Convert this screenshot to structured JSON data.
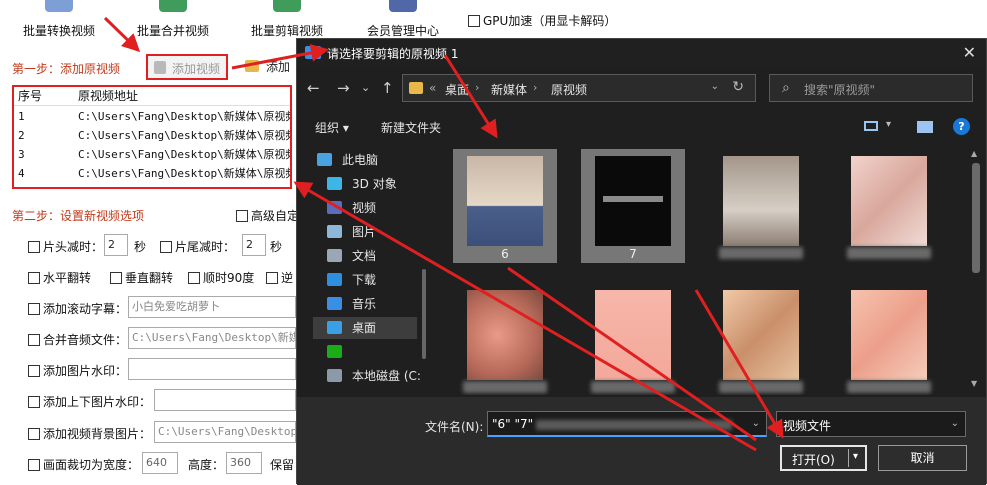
{
  "toolbar": {
    "items": [
      {
        "label": "批量转换视频",
        "icon": "convert-video-icon",
        "color": "#7e9fd6"
      },
      {
        "label": "批量合并视频",
        "icon": "merge-video-icon",
        "color": "#3f9c5a"
      },
      {
        "label": "批量剪辑视频",
        "icon": "cut-video-icon",
        "color": "#3f9c5a"
      },
      {
        "label": "会员管理中心",
        "icon": "member-icon",
        "color": "#5068a8"
      }
    ],
    "gpu_label": "GPU加速（用显卡解码）"
  },
  "step1": {
    "title": "第一步：添加原视频",
    "add_video": "添加视频",
    "add_folder": "添加"
  },
  "video_table": {
    "headers": [
      "序号",
      "原视频地址"
    ],
    "rows": [
      {
        "index": "1",
        "path": "C:\\Users\\Fang\\Desktop\\新媒体\\原视频"
      },
      {
        "index": "2",
        "path": "C:\\Users\\Fang\\Desktop\\新媒体\\原视频"
      },
      {
        "index": "3",
        "path": "C:\\Users\\Fang\\Desktop\\新媒体\\原视频"
      },
      {
        "index": "4",
        "path": "C:\\Users\\Fang\\Desktop\\新媒体\\原视频"
      }
    ]
  },
  "step2": {
    "title": "第二步：设置新视频选项",
    "advanced": "高级自定"
  },
  "options": {
    "head_cut": "片头减时：",
    "head_value": "2",
    "tail_cut": "片尾减时：",
    "tail_value": "2",
    "seconds": "秒",
    "flip_h": "水平翻转",
    "flip_v": "垂直翻转",
    "rotate90": "顺时90度",
    "reverse": "逆",
    "subtitle": "添加滚动字幕：",
    "subtitle_value": "小白免爱吃胡萝卜",
    "audio": "合并音频文件：",
    "audio_value": "C:\\Users\\Fang\\Desktop\\新媒体",
    "watermark": "添加图片水印：",
    "updown_watermark": "添加上下图片水印：",
    "bg_image": "添加视频背景图片：",
    "bg_value": "C:\\Users\\Fang\\Desktop\\新",
    "crop": "画面裁切为宽度：",
    "crop_width": "640",
    "height_label": "高度：",
    "crop_height": "360",
    "keep": "保留"
  },
  "dialog": {
    "title": "请选择要剪辑的原视频 1",
    "close": "✕",
    "nav": {
      "back": "←",
      "forward": "→",
      "up": "↑",
      "dropdown": "⌄"
    },
    "breadcrumb": [
      "«",
      "桌面",
      "新媒体",
      "原视频"
    ],
    "search_placeholder": "搜索\"原视频\"",
    "organize": "组织 ▾",
    "new_folder": "新建文件夹",
    "nav_pane": [
      {
        "label": "此电脑",
        "icon": "this-pc-icon",
        "color": "#4aa3e0"
      },
      {
        "label": "3D 对象",
        "icon": "3d-objects-icon",
        "color": "#3db5e6"
      },
      {
        "label": "视频",
        "icon": "videos-icon",
        "color": "#5a6cbc"
      },
      {
        "label": "图片",
        "icon": "pictures-icon",
        "color": "#8fb8d8"
      },
      {
        "label": "文档",
        "icon": "documents-icon",
        "color": "#9aa7b4"
      },
      {
        "label": "下载",
        "icon": "downloads-icon",
        "color": "#2e8fe0"
      },
      {
        "label": "音乐",
        "icon": "music-icon",
        "color": "#3a8ee6"
      },
      {
        "label": "桌面",
        "icon": "desktop-icon",
        "color": "#3aa0e6"
      },
      {
        "label": "",
        "icon": "wechat-icon",
        "color": "#1aad19"
      },
      {
        "label": "本地磁盘 (C:",
        "icon": "drive-icon",
        "color": "#8a9aa8"
      }
    ],
    "files": [
      {
        "label": "6",
        "thumb": "#d9c7b5",
        "selected": true
      },
      {
        "label": "7",
        "thumb": "#0a0a0a",
        "selected": true
      },
      {
        "label": "",
        "thumb": "#b7a89a",
        "selected": false
      },
      {
        "label": "",
        "thumb": "#e9c7bf",
        "selected": false
      },
      {
        "label": "",
        "thumb": "#c98a7a",
        "selected": false
      },
      {
        "label": "",
        "thumb": "#f4b4a8",
        "selected": false
      },
      {
        "label": "",
        "thumb": "#e3b79c",
        "selected": false
      },
      {
        "label": "",
        "thumb": "#f1b7a2",
        "selected": false
      }
    ],
    "filename_label": "文件名(N):",
    "filename_value": "\"6\" \"7\"",
    "filetype": "视频文件",
    "open": "打开(O)",
    "cancel": "取消"
  },
  "colors": {
    "annotation_red": "#e02020",
    "step_title": "#c23b1c",
    "dialog_bg": "#1f1f1f",
    "accent_blue": "#1a78d6"
  }
}
